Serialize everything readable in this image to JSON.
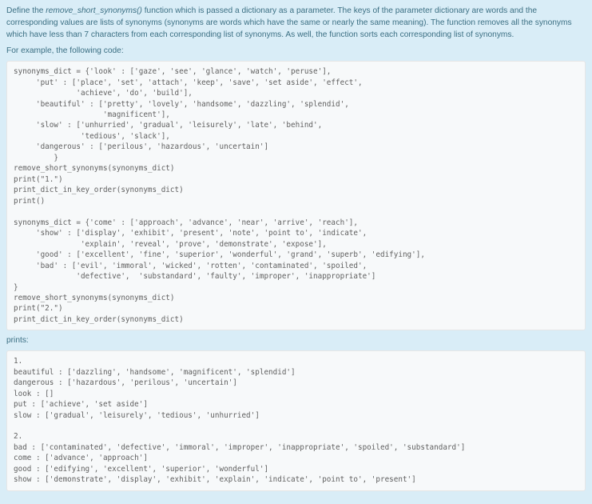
{
  "intro": {
    "part1": "Define the ",
    "funcname": "remove_short_synonyms()",
    "part2": " function which is passed a dictionary as a parameter.  The keys of the parameter dictionary are words and the corresponding values are lists of synonyms (synonyms are words which have the same or nearly the same meaning).  The function removes all the synonyms which have less than 7 characters from each corresponding list of synonyms.  As well, the function sorts each corresponding list of synonyms."
  },
  "example_label": "For example, the following code:",
  "code": "synonyms_dict = {'look' : ['gaze', 'see', 'glance', 'watch', 'peruse'],\n     'put' : ['place', 'set', 'attach', 'keep', 'save', 'set aside', 'effect',\n              'achieve', 'do', 'build'],\n     'beautiful' : ['pretty', 'lovely', 'handsome', 'dazzling', 'splendid',\n                    'magnificent'],\n     'slow' : ['unhurried', 'gradual', 'leisurely', 'late', 'behind',\n               'tedious', 'slack'],\n     'dangerous' : ['perilous', 'hazardous', 'uncertain']\n         }\nremove_short_synonyms(synonyms_dict)\nprint(\"1.\")\nprint_dict_in_key_order(synonyms_dict)\nprint()\n\nsynonyms_dict = {'come' : ['approach', 'advance', 'near', 'arrive', 'reach'],\n     'show' : ['display', 'exhibit', 'present', 'note', 'point to', 'indicate',\n               'explain', 'reveal', 'prove', 'demonstrate', 'expose'],\n     'good' : ['excellent', 'fine', 'superior', 'wonderful', 'grand', 'superb', 'edifying'],\n     'bad' : ['evil', 'immoral', 'wicked', 'rotten', 'contaminated', 'spoiled',\n              'defective',  'substandard', 'faulty', 'improper', 'inappropriate']\n}\nremove_short_synonyms(synonyms_dict)\nprint(\"2.\")\nprint_dict_in_key_order(synonyms_dict)",
  "prints_label": "prints:",
  "output": "1.\nbeautiful : ['dazzling', 'handsome', 'magnificent', 'splendid']\ndangerous : ['hazardous', 'perilous', 'uncertain']\nlook : []\nput : ['achieve', 'set aside']\nslow : ['gradual', 'leisurely', 'tedious', 'unhurried']\n\n2.\nbad : ['contaminated', 'defective', 'immoral', 'improper', 'inappropriate', 'spoiled', 'substandard']\ncome : ['advance', 'approach']\ngood : ['edifying', 'excellent', 'superior', 'wonderful']\nshow : ['demonstrate', 'display', 'exhibit', 'explain', 'indicate', 'point to', 'present']"
}
